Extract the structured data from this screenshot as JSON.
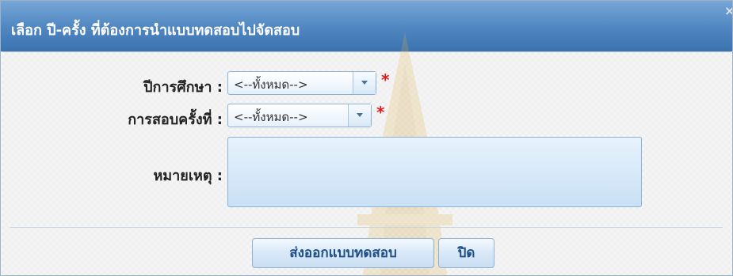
{
  "dialog": {
    "title": "เลือก ปี-ครั้ง ที่ต้องการนำแบบทดสอบไปจัดสอบ",
    "close_glyph": "×"
  },
  "form": {
    "year_label": "ปีการศึกษา :",
    "year_value": "<--ทั้งหมด-->",
    "round_label": "การสอบครั้งที่ :",
    "round_value": "<--ทั้งหมด-->",
    "remark_label": "หมายเหตุ :",
    "remark_value": "",
    "required_mark": "*"
  },
  "buttons": {
    "export_label": "ส่งออกแบบทดสอบ",
    "close_label": "ปิด"
  },
  "icons": {
    "dropdown": "chevron-down-icon",
    "close": "close-icon"
  },
  "colors": {
    "titlebar": "#4f86c0",
    "required": "#e01b1b",
    "button_text": "#1d4e86"
  }
}
